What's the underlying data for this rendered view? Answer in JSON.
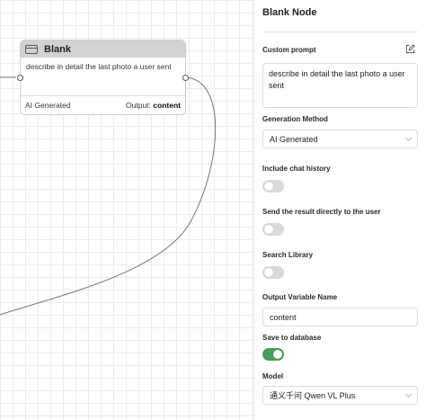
{
  "canvas": {
    "node": {
      "title": "Blank",
      "prompt": "describe in detail the last photo a user sent",
      "generation": "AI Generated",
      "output_label": "Output:",
      "output_var": "content"
    }
  },
  "panel": {
    "title": "Blank Node",
    "custom_prompt": {
      "label": "Custom prompt",
      "value": "describe in detail the last photo a user sent"
    },
    "generation_method": {
      "label": "Generation Method",
      "selected": "AI Generated"
    },
    "include_chat_history": {
      "label": "Include chat history",
      "on": false
    },
    "send_result": {
      "label": "Send the result directly to the user",
      "on": false
    },
    "search_library": {
      "label": "Search Library",
      "on": false
    },
    "output_variable": {
      "label": "Output Variable Name",
      "value": "content"
    },
    "save_to_database": {
      "label": "Save to database",
      "on": true
    },
    "model": {
      "label": "Model",
      "selected": "通义千问 Qwen VL Plus"
    }
  },
  "colors": {
    "toggle_on": "#4a9b5f",
    "toggle_off": "#d9d9d9",
    "node_header": "#d2d2d2"
  },
  "icons": {
    "node": "node-window-icon",
    "edit": "edit-icon",
    "dropdown": "chevron-down-icon"
  }
}
